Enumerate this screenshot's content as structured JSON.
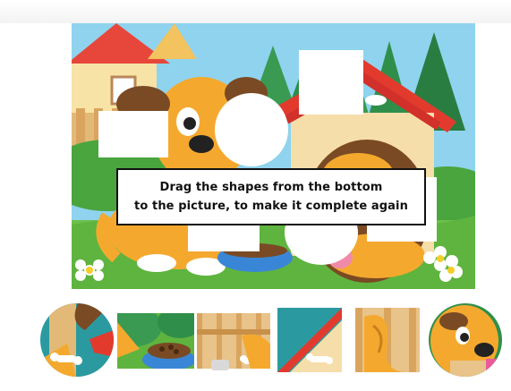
{
  "game": {
    "instruction_line1": "Drag the shapes from the bottom",
    "instruction_line2": "to the picture, to make it complete again"
  },
  "holes": [
    {
      "shape": "square",
      "filled": false
    },
    {
      "shape": "circle",
      "filled": false
    },
    {
      "shape": "square",
      "filled": false
    },
    {
      "shape": "square",
      "filled": false
    },
    {
      "shape": "circle",
      "filled": false
    },
    {
      "shape": "square",
      "filled": false
    }
  ],
  "tray_pieces": [
    {
      "shape": "circle",
      "depicts": "fence-and-bone"
    },
    {
      "shape": "square",
      "depicts": "bushes-and-food-bowl"
    },
    {
      "shape": "square",
      "depicts": "fence-and-bone"
    },
    {
      "shape": "square",
      "depicts": "doghouse-roof"
    },
    {
      "shape": "square",
      "depicts": "dog-tail"
    },
    {
      "shape": "circle",
      "depicts": "dog-face"
    }
  ],
  "colors": {
    "sky": "#8fd3ee",
    "grass": "#6cc04a",
    "dog": "#f4a92e",
    "doghouse_roof": "#e23b2e",
    "bowl": "#3a86d6"
  }
}
